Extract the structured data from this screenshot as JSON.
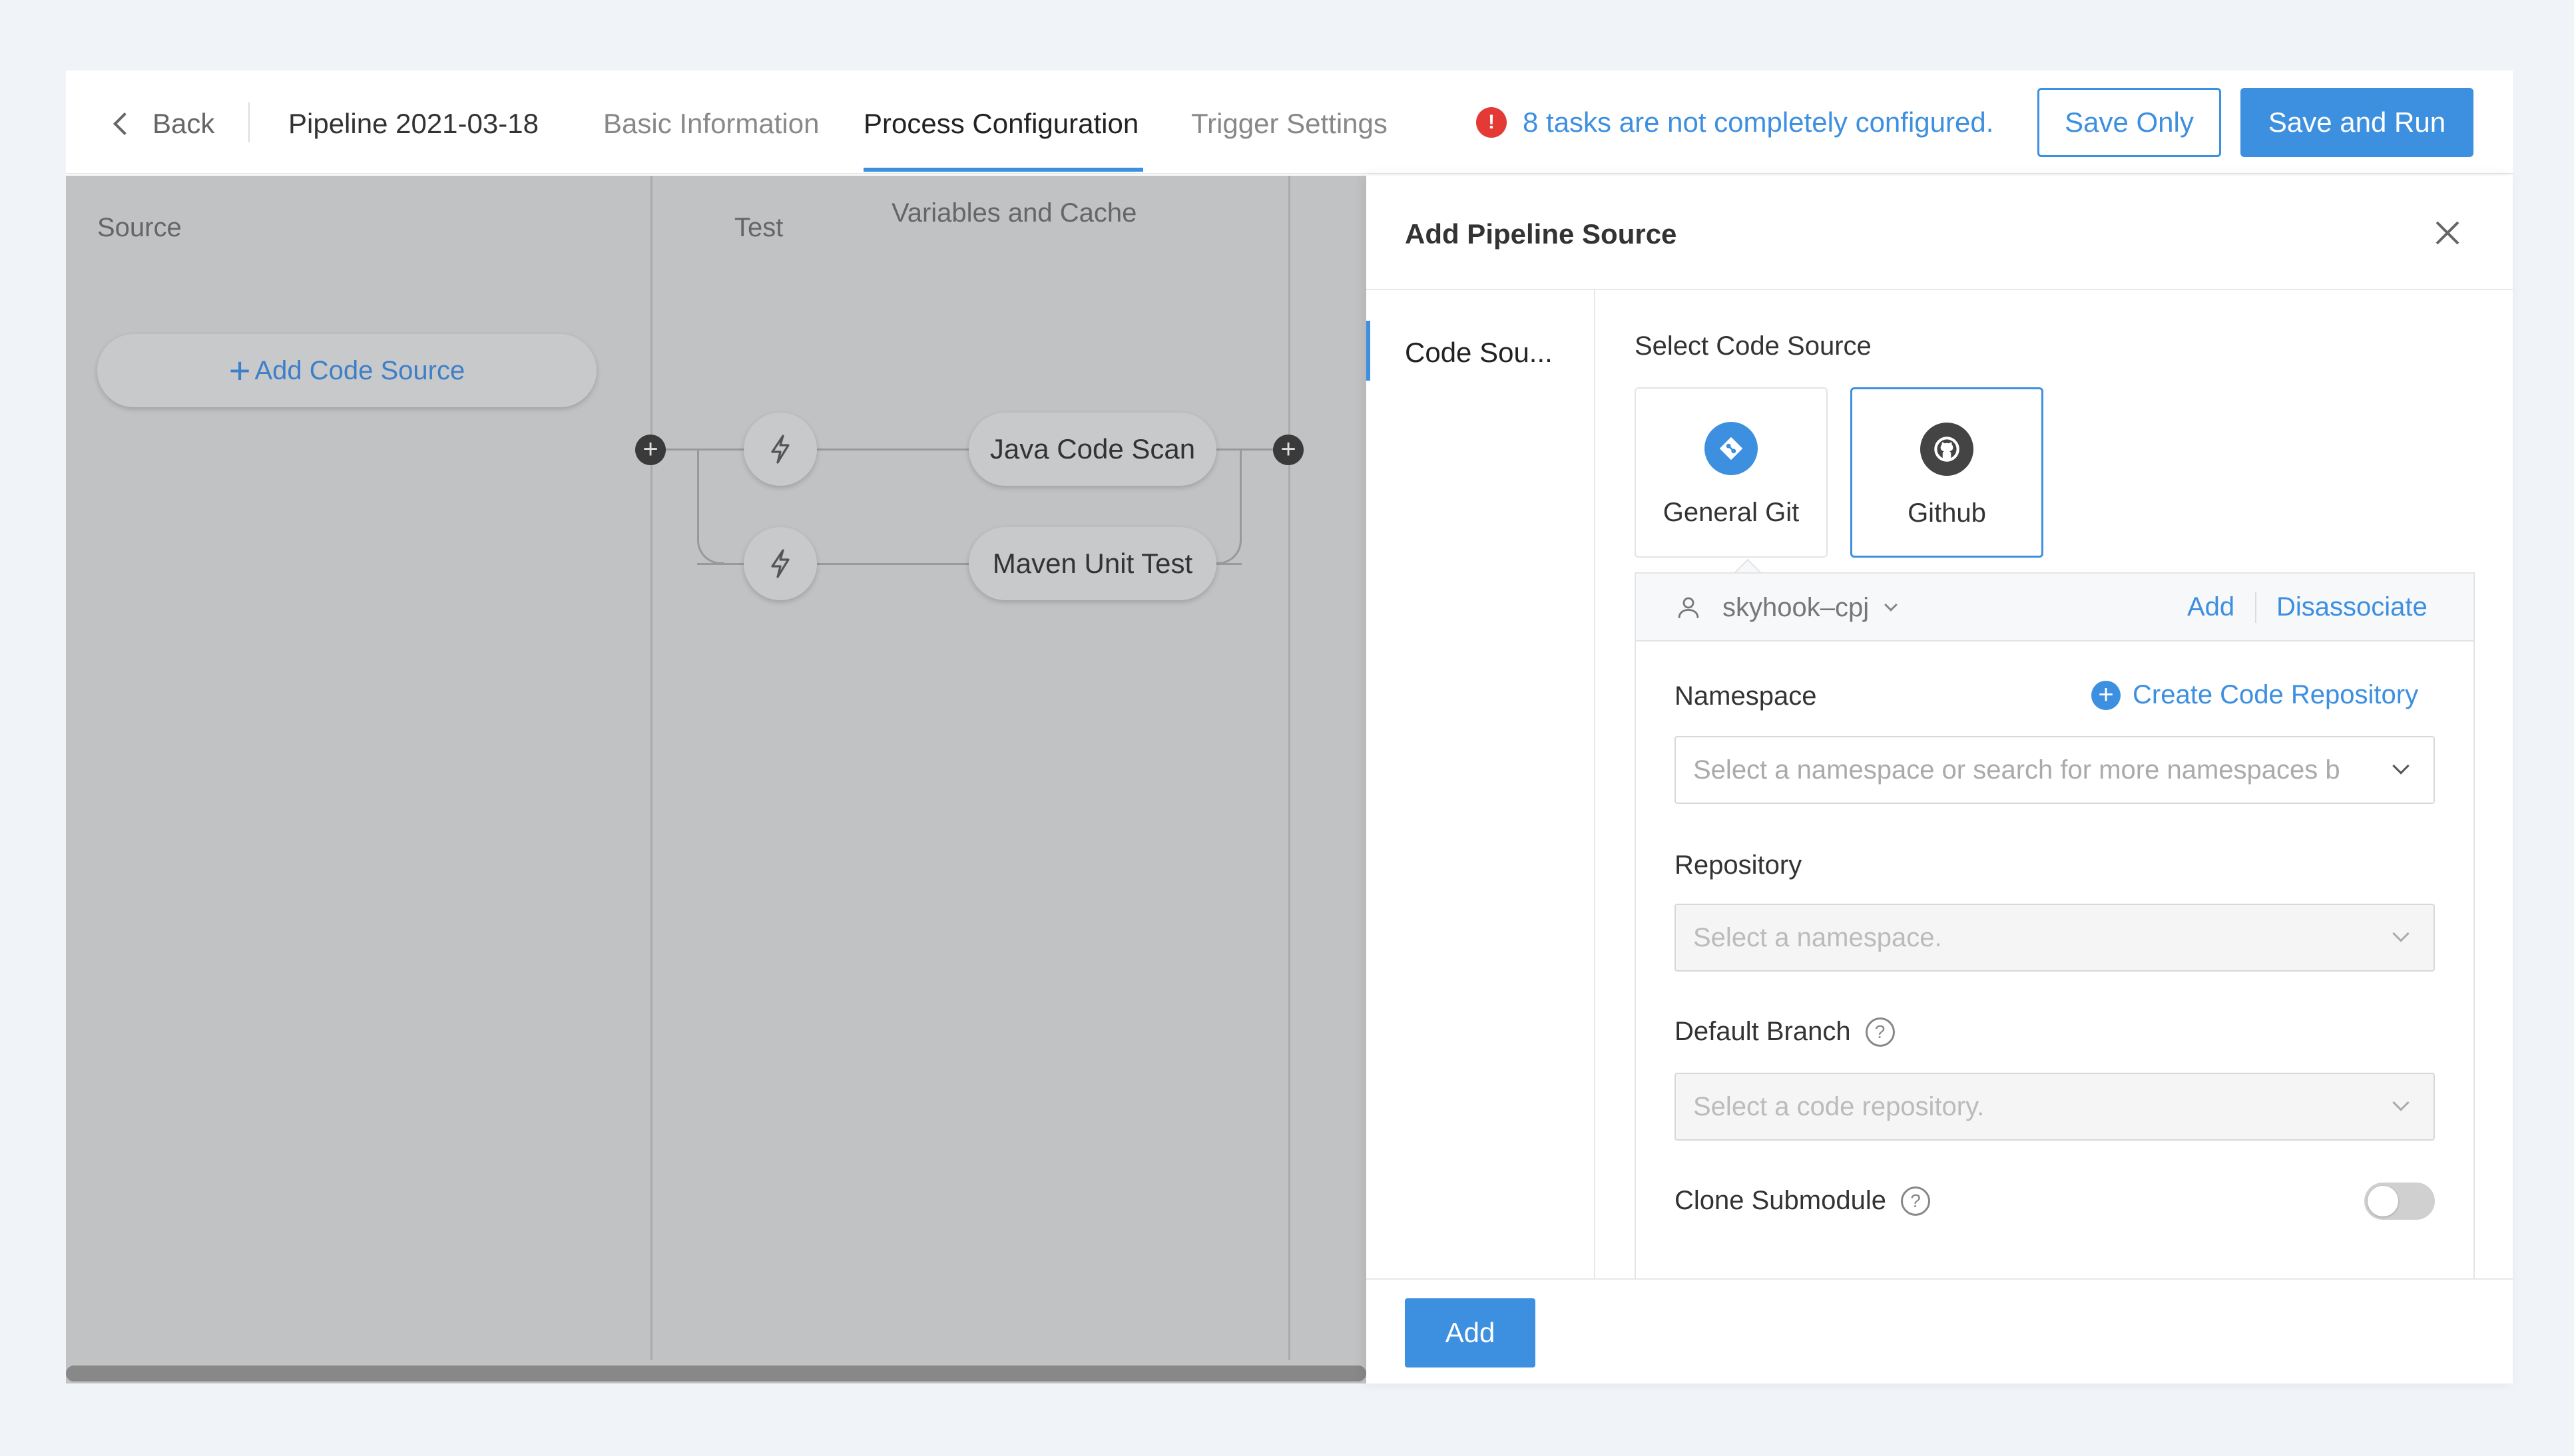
{
  "header": {
    "back_label": "Back",
    "pipeline_name": "Pipeline 2021-03-18",
    "tabs": [
      {
        "label": "Basic Information",
        "active": false
      },
      {
        "label": "Process Configuration",
        "active": true
      },
      {
        "label": "Trigger Settings",
        "active": false
      }
    ],
    "warning_text": "8 tasks are not completely configured.",
    "warning_icon": "!",
    "save_only_label": "Save Only",
    "save_and_run_label": "Save and Run"
  },
  "canvas": {
    "stages": [
      {
        "title": "Source"
      },
      {
        "title": "Test"
      },
      {
        "title": "Variables and Cache"
      }
    ],
    "add_code_source_label": "Add Code Source",
    "tasks": [
      {
        "label": "Java Code Scan",
        "icon": "bolt-icon"
      },
      {
        "label": "Maven Unit Test",
        "icon": "bolt-icon"
      }
    ]
  },
  "drawer": {
    "title": "Add Pipeline Source",
    "side_nav": [
      {
        "label": "Code Sou...",
        "active": true
      }
    ],
    "select_code_source_label": "Select Code Source",
    "sources": [
      {
        "name": "General Git",
        "icon": "git-icon",
        "selected": false
      },
      {
        "name": "Github",
        "icon": "github-icon",
        "selected": true
      }
    ],
    "account": {
      "name": "skyhook–cpj",
      "add_label": "Add",
      "disassociate_label": "Disassociate"
    },
    "namespace": {
      "label": "Namespace",
      "create_repo_label": "Create Code Repository",
      "placeholder": "Select a namespace or search for more namespaces b"
    },
    "repository": {
      "label": "Repository",
      "placeholder": "Select a namespace."
    },
    "default_branch": {
      "label": "Default Branch",
      "placeholder": "Select a code repository."
    },
    "clone_submodule": {
      "label": "Clone Submodule",
      "enabled": false
    },
    "add_button_label": "Add"
  },
  "colors": {
    "accent": "#3d8fe0",
    "warning": "#e53935",
    "overlay": "#c1c2c4"
  }
}
